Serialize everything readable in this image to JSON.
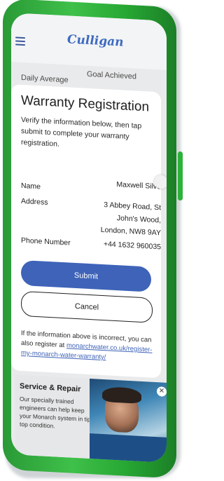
{
  "app": {
    "logo_text": "Culligan"
  },
  "stats": {
    "left_label": "Daily Average",
    "right_label": "Goal Achieved"
  },
  "modal": {
    "title": "Warranty Registration",
    "description": "Verify the information below, then tap submit to complete your warranty registration.",
    "fields": [
      {
        "label": "Name",
        "value_lines": [
          "Maxwell Silve"
        ]
      },
      {
        "label": "Address",
        "value_lines": [
          "3 Abbey Road, St",
          "John's Wood,",
          "London, NW8 9AY"
        ]
      },
      {
        "label": "Phone Number",
        "value_lines": [
          "+44 1632 960035"
        ]
      }
    ],
    "submit_label": "Submit",
    "cancel_label": "Cancel",
    "footnote_text": "If the information above is incorrect, you can also register at ",
    "footnote_link": "monarchwater.co.uk/register-my-monarch-water-warranty/"
  },
  "service_card": {
    "title": "Service & Repair",
    "text": "Our specially trained engineers can help keep your Monarch system in tip top condition."
  },
  "colors": {
    "primary": "#3e63b8",
    "frame": "#3fc04a"
  },
  "icons": {
    "menu": "hamburger-menu-icon",
    "close": "close-icon"
  }
}
